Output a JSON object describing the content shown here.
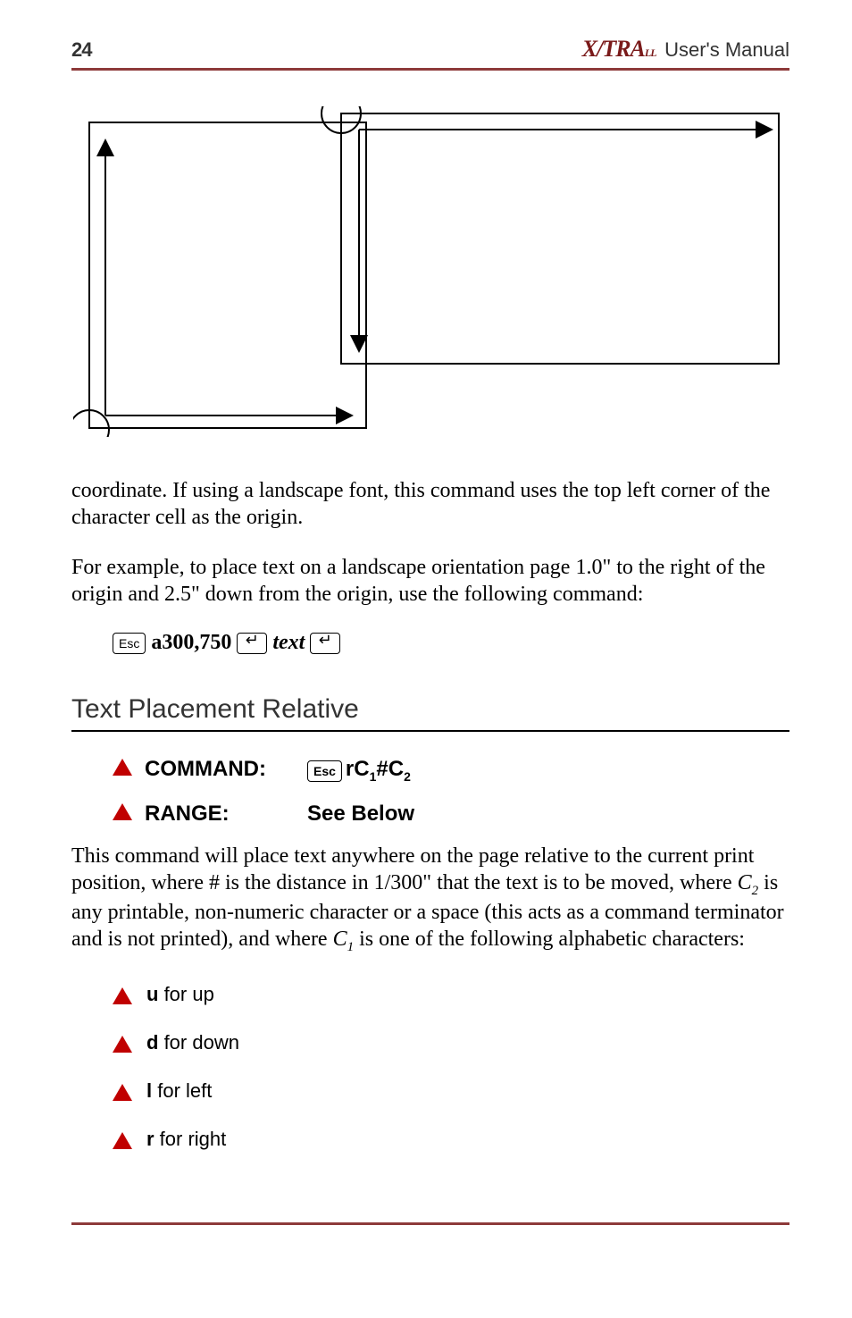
{
  "header": {
    "page_no": "24",
    "brand_prefix": "X",
    "brand_suffix": "TRA",
    "brand_small": "LL",
    "title_suffix": "User's Manual"
  },
  "para1": "coordinate. If using a landscape font, this command uses the top left corner of the character cell as the origin.",
  "para2": "For example, to place text on a landscape orientation page 1.0\" to the right of the origin and 2.5\" down from the origin, use the following command:",
  "cmd_example": {
    "esc": "Esc",
    "code": "a300,750",
    "text_word": "text"
  },
  "section_title": "Text Placement Relative",
  "meta": {
    "command_label": "COMMAND:",
    "command_esc": "Esc",
    "command_code_prefix": "rC",
    "command_code_mid": "#C",
    "sub1": "1",
    "sub2": "2",
    "range_label": "RANGE:",
    "range_value": "See Below"
  },
  "para3_a": "This command will place text anywhere on the page relative to the current print position, where # is the distance in 1/300\" that the text is to be moved, where ",
  "para3_c2": "C",
  "para3_c2_sub": "2",
  "para3_b": " is any printable, non-numeric character or a space (this acts as a command terminator and is not printed), and where ",
  "para3_c1": "C",
  "para3_c1_sub": "1",
  "para3_c": " is one of the following alphabetic characters:",
  "dirs": [
    {
      "key": "u",
      "label": " for up"
    },
    {
      "key": "d",
      "label": " for down"
    },
    {
      "key": "l",
      "label": " for left"
    },
    {
      "key": "r",
      "label": " for right"
    }
  ]
}
